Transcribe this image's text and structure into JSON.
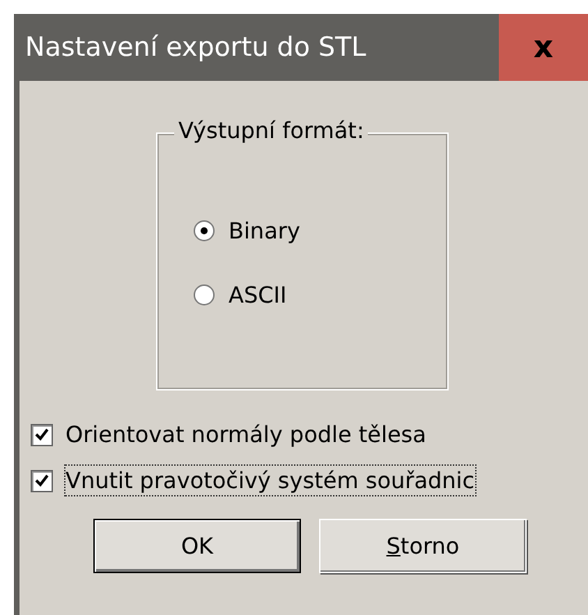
{
  "window": {
    "title": "Nastavení exportu do STL",
    "close": "x"
  },
  "format_group": {
    "label": "Výstupní formát:",
    "options": [
      {
        "label": "Binary",
        "selected": true
      },
      {
        "label": "ASCII",
        "selected": false
      }
    ]
  },
  "checkboxes": [
    {
      "label": "Orientovat normály podle tělesa",
      "checked": true,
      "focused": false
    },
    {
      "label": "Vnutit pravotočivý systém souřadnic",
      "checked": true,
      "focused": true
    }
  ],
  "buttons": [
    {
      "label": "OK",
      "default": true,
      "mnemonic": false
    },
    {
      "label": "Storno",
      "default": false,
      "mnemonic": true
    }
  ]
}
